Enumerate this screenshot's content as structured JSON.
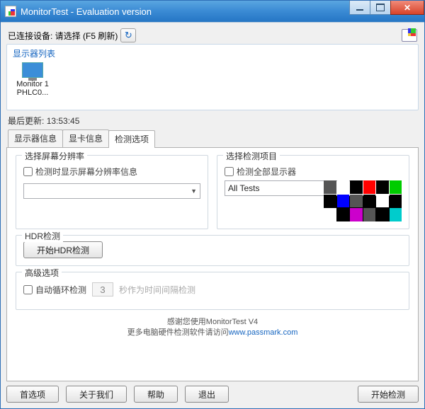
{
  "window": {
    "title": "MonitorTest - Evaluation version"
  },
  "top": {
    "connected_label": "已连接设备: 请选择 (F5 刷新)"
  },
  "monlist": {
    "title": "显示器列表",
    "items": [
      {
        "name": "Monitor 1",
        "model": "PHLC0..."
      }
    ]
  },
  "lastupdate": {
    "label": "最后更新:",
    "time": "13:53:45"
  },
  "tabs": {
    "items": [
      {
        "id": "info",
        "label": "显示器信息"
      },
      {
        "id": "gpu",
        "label": "显卡信息"
      },
      {
        "id": "opts",
        "label": "检测选项"
      }
    ],
    "active": "opts"
  },
  "opts": {
    "resolution": {
      "title": "选择屏幕分辨率",
      "checkbox": "检测时显示屏幕分辨率信息",
      "value": ""
    },
    "testitems": {
      "title": "选择检测项目",
      "checkbox": "检测全部显示器",
      "value": "All Tests"
    },
    "hdr": {
      "title": "HDR检测",
      "button": "开始HDR检测"
    },
    "advanced": {
      "title": "高级选项",
      "loop_checkbox": "自动循环检测",
      "interval_value": "3",
      "interval_suffix": "秒作为时间间隔检测"
    }
  },
  "footer": {
    "thank": "感谢您使用MonitorTest V4",
    "more": "更多电脑硬件检测软件请访问",
    "link": "www.passmark.com"
  },
  "buttons": {
    "prefs": "首选项",
    "about": "关于我们",
    "help": "帮助",
    "exit": "退出",
    "start": "开始检测"
  }
}
